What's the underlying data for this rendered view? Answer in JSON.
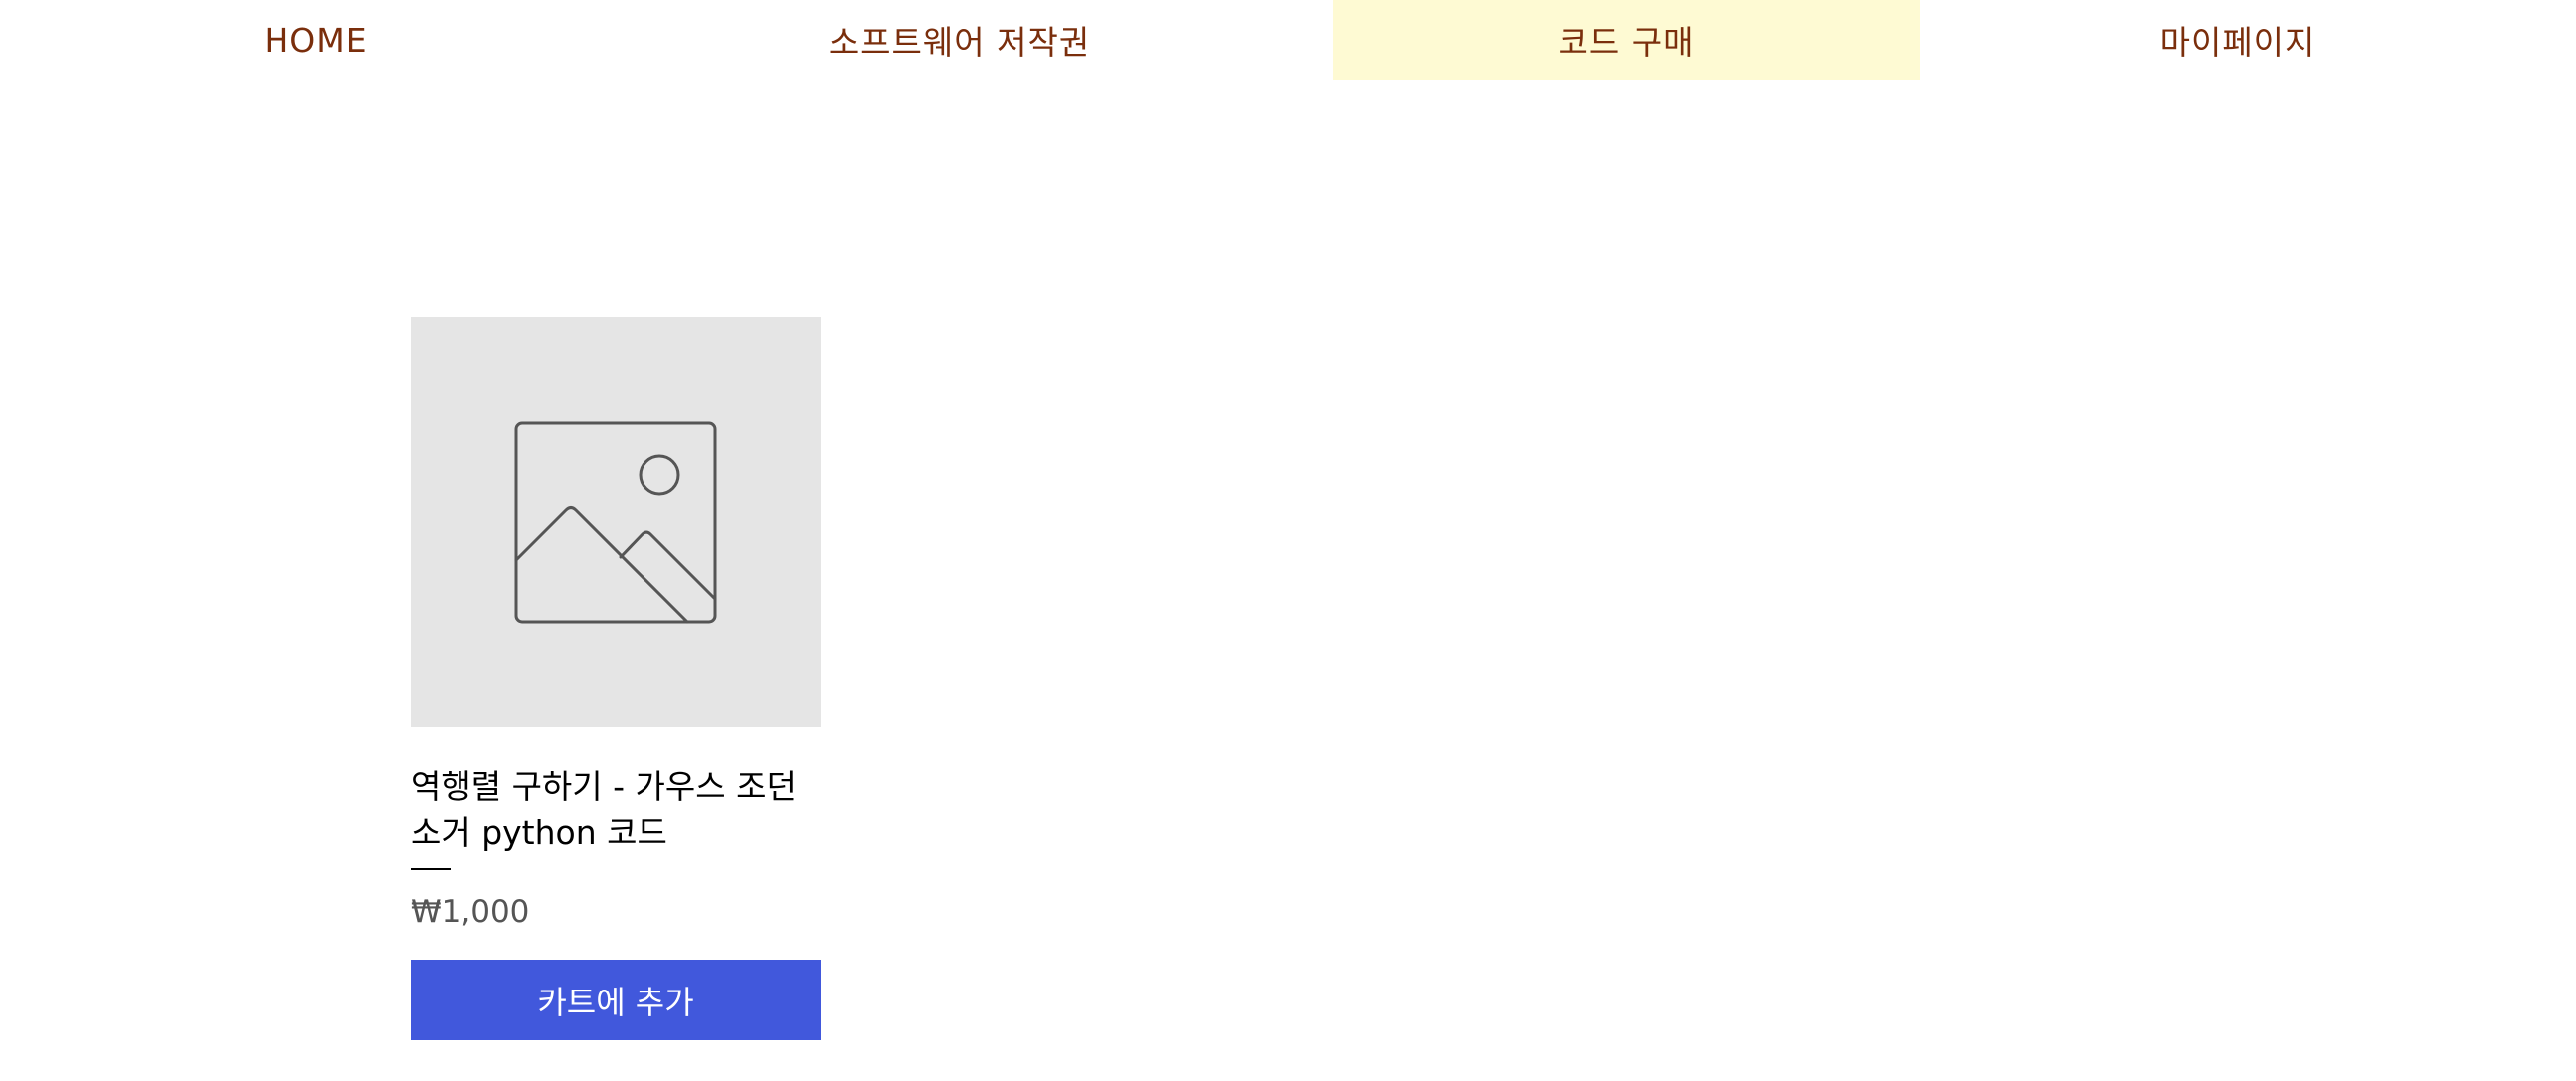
{
  "nav": {
    "items": [
      {
        "label": "HOME",
        "active": false
      },
      {
        "label": "소프트웨어 저작권",
        "active": false
      },
      {
        "label": "코드 구매",
        "active": true
      },
      {
        "label": "마이페이지",
        "active": false
      }
    ]
  },
  "product": {
    "image_icon": "image-placeholder-icon",
    "title": "역행렬 구하기 - 가우스 조던 소거 python 코드",
    "price": "₩1,000",
    "button_label": "카트에 추가"
  },
  "colors": {
    "nav_text": "#7a2e0c",
    "nav_active_bg": "#fefad3",
    "button_bg": "#4158dc",
    "image_bg": "#e5e5e5"
  }
}
